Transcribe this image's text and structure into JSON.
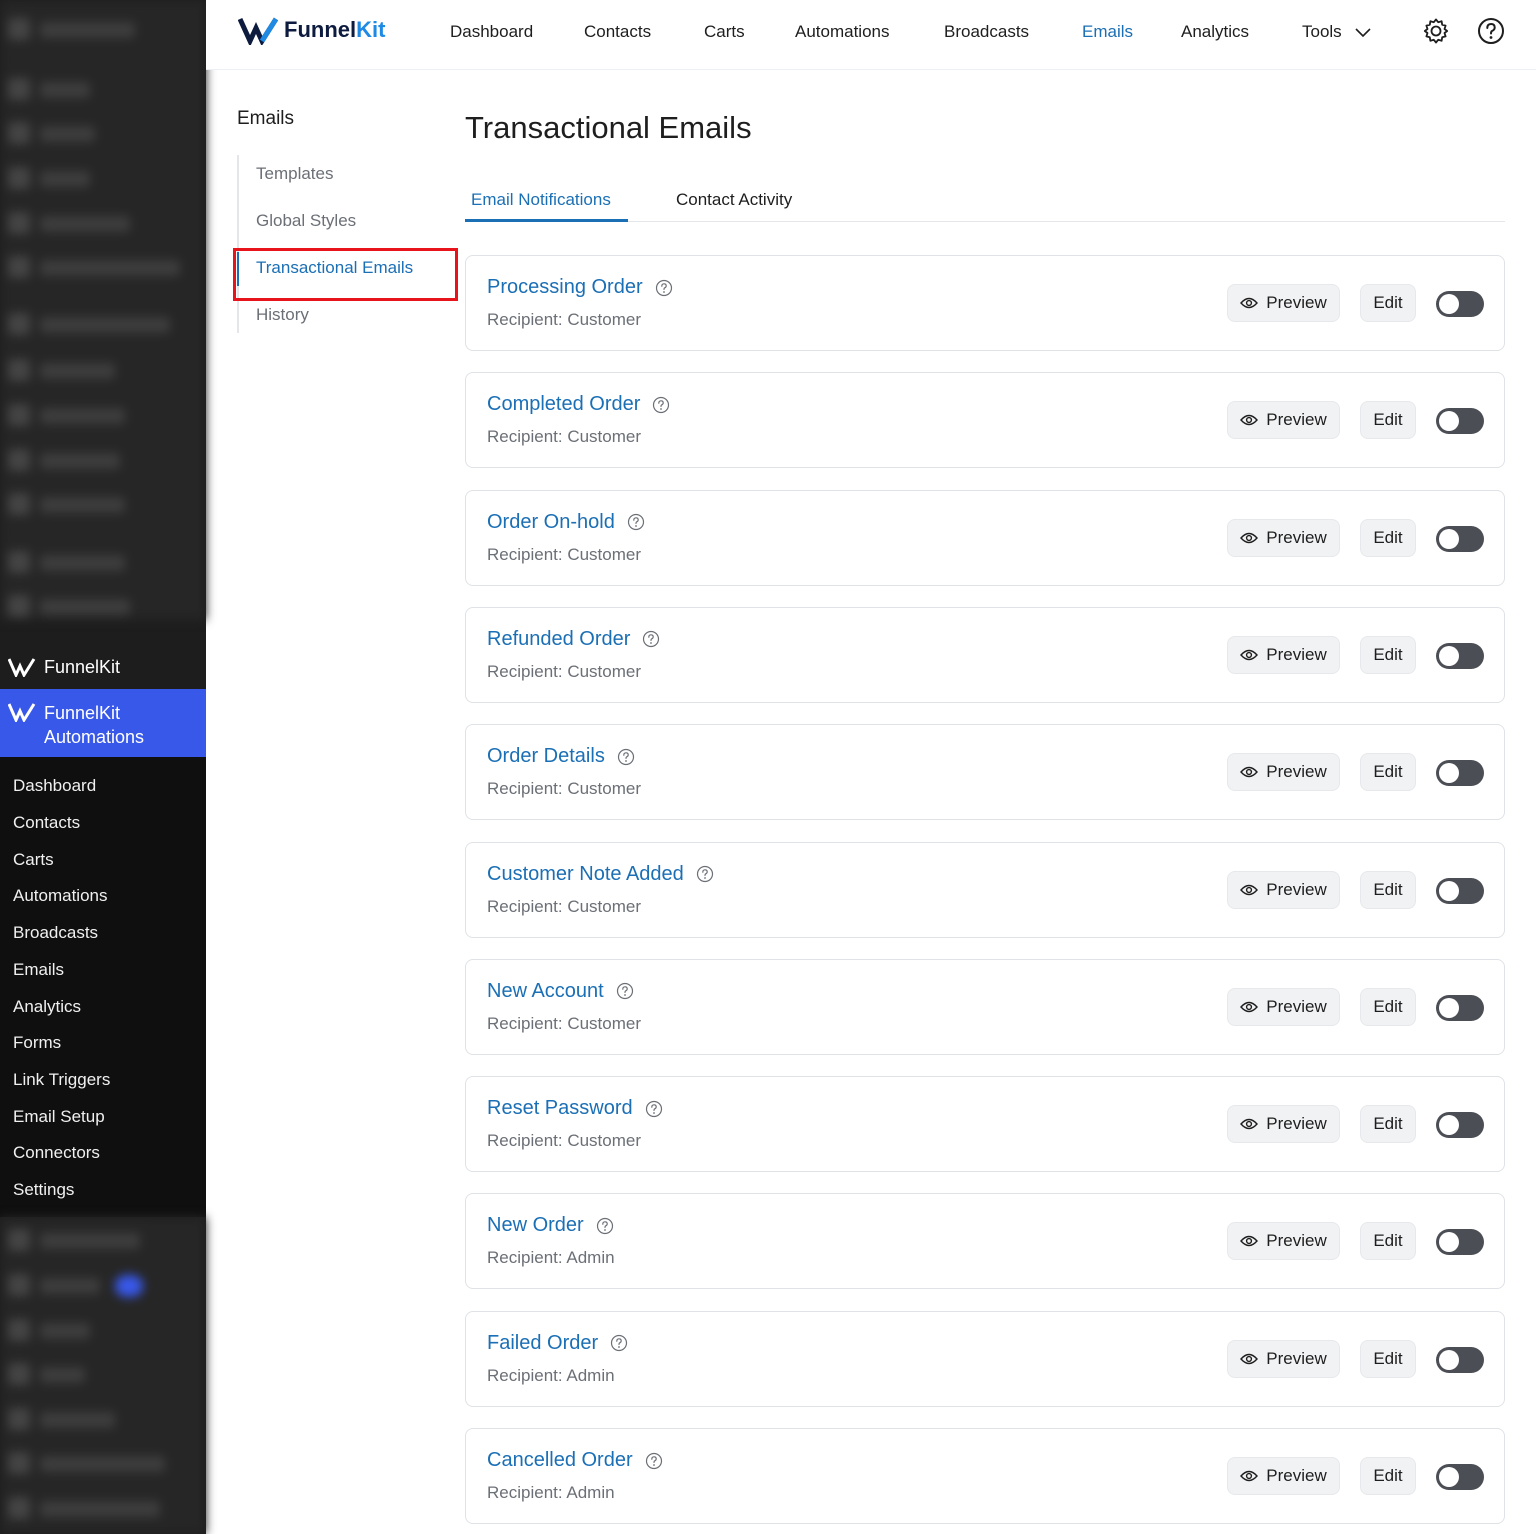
{
  "brand": {
    "name_part1": "Funnel",
    "name_part2": "Kit"
  },
  "top_nav": {
    "items": [
      "Dashboard",
      "Contacts",
      "Carts",
      "Automations",
      "Broadcasts",
      "Emails",
      "Analytics",
      "Tools"
    ],
    "active": "Emails"
  },
  "wp_sidebar": {
    "brand_label": "FunnelKit",
    "active_label_line1": "FunnelKit",
    "active_label_line2": "Automations",
    "sub_items": [
      "Dashboard",
      "Contacts",
      "Carts",
      "Automations",
      "Broadcasts",
      "Emails",
      "Analytics",
      "Forms",
      "Link Triggers",
      "Email Setup",
      "Connectors",
      "Settings"
    ]
  },
  "sub_sidebar": {
    "title": "Emails",
    "items": [
      "Templates",
      "Global Styles",
      "Transactional Emails",
      "History"
    ],
    "active": "Transactional Emails"
  },
  "main": {
    "title": "Transactional Emails",
    "tabs": [
      "Email Notifications",
      "Contact Activity"
    ],
    "active_tab": "Email Notifications",
    "preview_label": "Preview",
    "edit_label": "Edit",
    "emails": [
      {
        "title": "Processing Order",
        "recipient": "Recipient: Customer",
        "enabled": false
      },
      {
        "title": "Completed Order",
        "recipient": "Recipient: Customer",
        "enabled": false
      },
      {
        "title": "Order On-hold",
        "recipient": "Recipient: Customer",
        "enabled": false
      },
      {
        "title": "Refunded Order",
        "recipient": "Recipient: Customer",
        "enabled": false
      },
      {
        "title": "Order Details",
        "recipient": "Recipient: Customer",
        "enabled": false
      },
      {
        "title": "Customer Note Added",
        "recipient": "Recipient: Customer",
        "enabled": false
      },
      {
        "title": "New Account",
        "recipient": "Recipient: Customer",
        "enabled": false
      },
      {
        "title": "Reset Password",
        "recipient": "Recipient: Customer",
        "enabled": false
      },
      {
        "title": "New Order",
        "recipient": "Recipient: Admin",
        "enabled": false
      },
      {
        "title": "Failed Order",
        "recipient": "Recipient: Admin",
        "enabled": false
      },
      {
        "title": "Cancelled Order",
        "recipient": "Recipient: Admin",
        "enabled": false
      }
    ]
  },
  "icons": {
    "settings": "gear-icon",
    "help": "question-circle-icon",
    "preview": "eye-icon",
    "tools_dropdown": "chevron-down-icon"
  },
  "colors": {
    "accent": "#1b6fb5",
    "wp_active": "#3858e9",
    "highlight": "#e8141c",
    "toggle_off": "#4b4f55"
  }
}
